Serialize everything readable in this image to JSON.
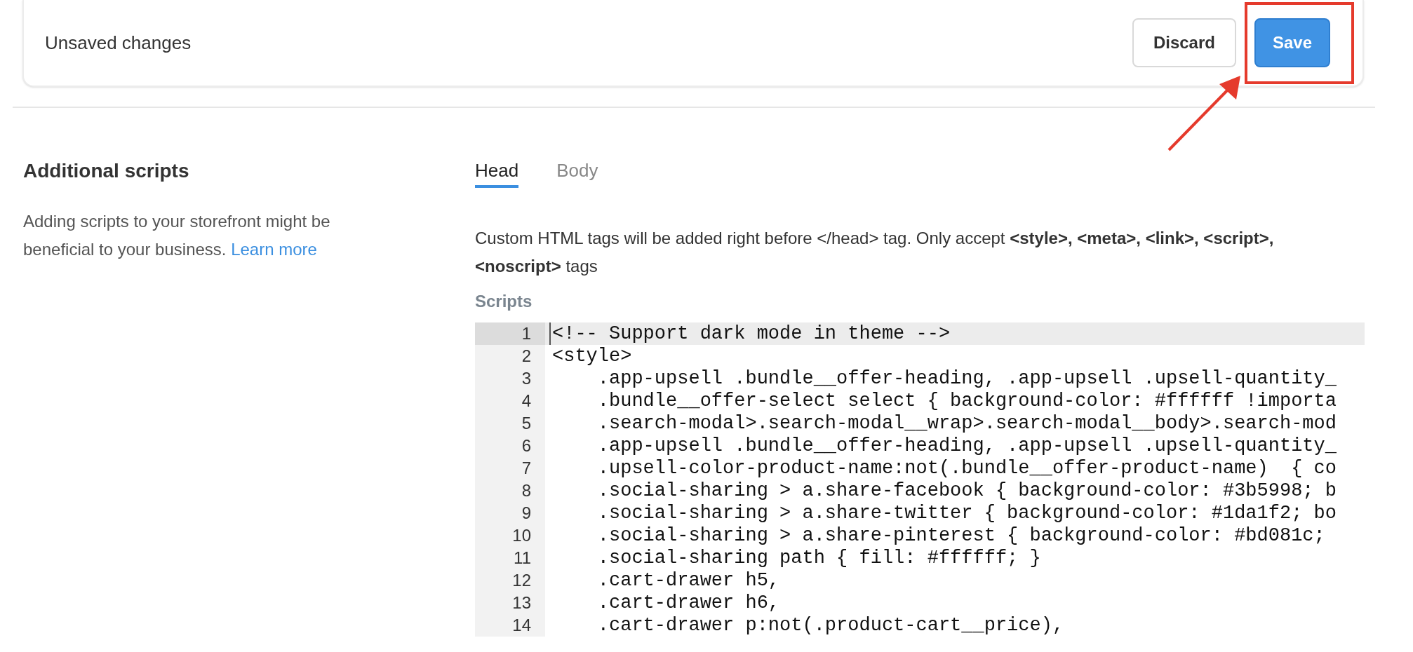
{
  "unsaved_bar": {
    "message": "Unsaved changes",
    "buttons": [
      {
        "label": "Discard",
        "kind": "secondary"
      },
      {
        "label": "Save",
        "kind": "primary"
      }
    ]
  },
  "annotation": {
    "save_highlighted": true
  },
  "section": {
    "title": "Additional scripts",
    "description": "Adding scripts to your storefront might be beneficial to your business.",
    "link": "Learn more"
  },
  "tabs": [
    {
      "label": "Head",
      "selected": true
    },
    {
      "label": "Body",
      "selected": false
    }
  ],
  "help_text": "Custom HTML tags will be added right before </head> tag. Only accept **<style>, <meta>, <link>, <script>, <noscript>** tags",
  "field_label": "Scripts",
  "code_lines": [
    {
      "number": "1",
      "text": "<!-- Support dark mode in theme -->",
      "selected": true
    },
    {
      "number": "2",
      "text": "<style>",
      "selected": false
    },
    {
      "number": "3",
      "text": "    .app-upsell .bundle__offer-heading, .app-upsell .upsell-quantity_",
      "selected": false
    },
    {
      "number": "4",
      "text": "    .bundle__offer-select select { background-color: #ffffff !importa",
      "selected": false
    },
    {
      "number": "5",
      "text": "    .search-modal>.search-modal__wrap>.search-modal__body>.search-mod",
      "selected": false
    },
    {
      "number": "6",
      "text": "    .app-upsell .bundle__offer-heading, .app-upsell .upsell-quantity_",
      "selected": false
    },
    {
      "number": "7",
      "text": "    .upsell-color-product-name:not(.bundle__offer-product-name)  { co",
      "selected": false
    },
    {
      "number": "8",
      "text": "    .social-sharing > a.share-facebook { background-color: #3b5998; b",
      "selected": false
    },
    {
      "number": "9",
      "text": "    .social-sharing > a.share-twitter { background-color: #1da1f2; bo",
      "selected": false
    },
    {
      "number": "10",
      "text": "    .social-sharing > a.share-pinterest { background-color: #bd081c;",
      "selected": false
    },
    {
      "number": "11",
      "text": "    .social-sharing path { fill: #ffffff; }",
      "selected": false
    },
    {
      "number": "12",
      "text": "    .cart-drawer h5,",
      "selected": false
    },
    {
      "number": "13",
      "text": "    .cart-drawer h6,",
      "selected": false
    },
    {
      "number": "14",
      "text": "    .cart-drawer p:not(.product-cart__price),",
      "selected": false
    }
  ]
}
